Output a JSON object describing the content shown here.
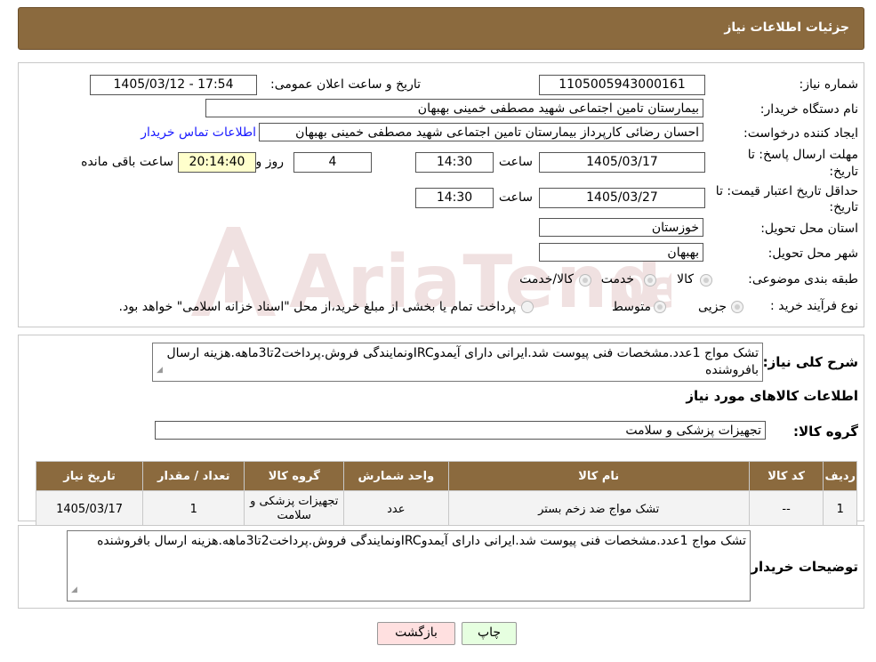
{
  "header": {
    "title": "جزئیات اطلاعات نیاز"
  },
  "form": {
    "need_number_label": "شماره نیاز:",
    "need_number": "1105005943000161",
    "announce_label": "تاریخ و ساعت اعلان عمومی:",
    "announce_value": "1405/03/12 - 17:54",
    "buyer_org_label": "نام دستگاه خریدار:",
    "buyer_org": "بیمارستان تامین اجتماعی شهید مصطفی خمینی بهبهان",
    "creator_label": "ایجاد کننده درخواست:",
    "creator": "احسان رضائی کارپرداز بیمارستان تامین اجتماعی شهید مصطفی خمینی بهبهان",
    "contact_link": "اطلاعات تماس خریدار",
    "deadline_label_1": "مهلت ارسال پاسخ: تا",
    "deadline_label_2": "تاریخ:",
    "deadline_date": "1405/03/17",
    "time_label": "ساعت",
    "deadline_time": "14:30",
    "days_value": "4",
    "days_label": "روز و",
    "remaining_value": "20:14:40",
    "remaining_label": "ساعت باقی مانده",
    "validity_label_1": "حداقل تاریخ اعتبار قیمت: تا",
    "validity_label_2": "تاریخ:",
    "validity_date": "1405/03/27",
    "validity_time": "14:30",
    "province_label": "استان محل تحویل:",
    "province": "خوزستان",
    "city_label": "شهر محل تحویل:",
    "city": "بهبهان",
    "category_label": "طبقه بندی موضوعی:",
    "category_options": [
      "کالا",
      "خدمت",
      "کالا/خدمت"
    ],
    "process_label": "نوع فرآیند خرید :",
    "process_options": [
      "جزیی",
      "متوسط"
    ],
    "process_note": "پرداخت تمام یا بخشی از مبلغ خرید،از محل \"اسناد خزانه اسلامی\" خواهد بود."
  },
  "description": {
    "label": "شرح کلی نیاز:",
    "text": "تشک مواج 1عدد.مشخصات فنی پیوست شد.ایرانی دارای آیمدوIRCونمایندگی فروش.پرداخت2تا3ماهه.هزینه ارسال بافروشنده"
  },
  "goods": {
    "section_title": "اطلاعات کالاهای مورد نیاز",
    "group_label": "گروه کالا:",
    "group_value": "تجهیزات پزشکی و سلامت",
    "columns": [
      "ردیف",
      "کد کالا",
      "نام کالا",
      "واحد شمارش",
      "گروه کالا",
      "تعداد / مقدار",
      "تاریخ نیاز"
    ],
    "rows": [
      [
        "1",
        "--",
        "تشک مواج ضد زخم بستر",
        "عدد",
        "تجهیزات پزشکی و سلامت",
        "1",
        "1405/03/17"
      ]
    ]
  },
  "buyer_notes": {
    "label": "توضیحات خریدار:",
    "text": "تشک مواج 1عدد.مشخصات فنی پیوست شد.ایرانی دارای آیمدوIRCونمایندگی فروش.پرداخت2تا3ماهه.هزینه ارسال بافروشنده"
  },
  "buttons": {
    "print": "چاپ",
    "back": "بازگشت"
  },
  "colors": {
    "header_bg": "#8b6a3e",
    "back_button_bg": "#ffe0e0",
    "print_button_bg": "#e6ffe0",
    "remaining_bg": "#ffffcc"
  }
}
